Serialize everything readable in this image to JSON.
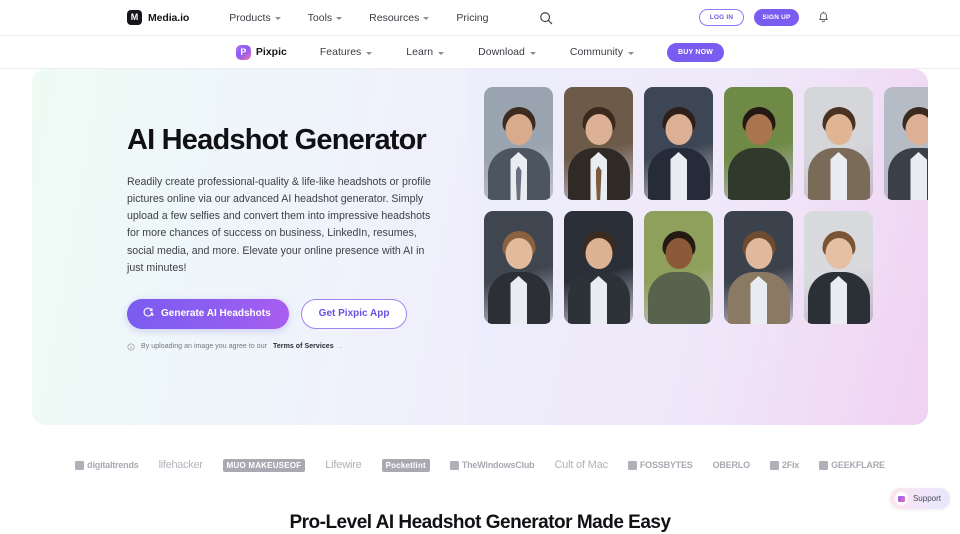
{
  "header": {
    "brand": {
      "name": "Media.io",
      "mark": "M",
      "icon": "mediaio-logo-icon"
    },
    "nav": [
      {
        "label": "Products",
        "has_caret": true
      },
      {
        "label": "Tools",
        "has_caret": true
      },
      {
        "label": "Resources",
        "has_caret": true
      },
      {
        "label": "Pricing",
        "has_caret": false
      }
    ],
    "search_icon": "search-icon",
    "login_label": "LOG IN",
    "signup_label": "SIGN UP",
    "bell_icon": "notification-bell-icon"
  },
  "subheader": {
    "brand": {
      "name": "Pixpic",
      "mark": "P",
      "icon": "pixpic-logo-icon"
    },
    "nav": [
      {
        "label": "Features",
        "has_caret": true
      },
      {
        "label": "Learn",
        "has_caret": true
      },
      {
        "label": "Download",
        "has_caret": true
      },
      {
        "label": "Community",
        "has_caret": true
      }
    ],
    "buy_now_label": "BUY NOW"
  },
  "hero": {
    "title": "AI Headshot Generator",
    "description": "Readily create professional-quality & life-like headshots or profile pictures online via our advanced AI headshot generator. Simply upload a few selfies and convert them into impressive headshots for more chances of success on business, LinkedIn, resumes, social media, and more. Elevate your online presence with AI in just minutes!",
    "primary_button": {
      "label": "Generate AI Headshots",
      "icon": "ai-magic-icon"
    },
    "secondary_button": {
      "label": "Get Pixpic App"
    },
    "terms": {
      "icon": "info-circle-icon",
      "prefix": "By uploading an image you agree to our ",
      "link_label": "Terms of Services",
      "suffix": "."
    },
    "gallery": {
      "rows": [
        [
          {
            "alt": "headshot-man-grey-suit",
            "skin": "#d9ab8d",
            "hair": "#3d2b20",
            "jacket": "#4d5560",
            "accent": "#6b717c",
            "bg": "#9aa4b0",
            "type": "suit"
          },
          {
            "alt": "headshot-man-brown-tie",
            "skin": "#dcb094",
            "hair": "#3a2a1e",
            "jacket": "#2f2a26",
            "accent": "#7a5c3c",
            "bg": "#6d5a49",
            "type": "suit"
          },
          {
            "alt": "headshot-man-navy-blazer",
            "skin": "#dcb094",
            "hair": "#2e2018",
            "jacket": "#262b3a",
            "accent": "#262b3a",
            "bg": "#3d4654",
            "type": "open"
          },
          {
            "alt": "headshot-man-green-tshirt",
            "skin": "#a9754e",
            "hair": "#241812",
            "jacket": "#2f3a2c",
            "accent": "#2f3a2c",
            "bg": "#6f8a47",
            "type": "casual"
          },
          {
            "alt": "headshot-man-tan-blazer",
            "skin": "#e0b594",
            "hair": "#4a3220",
            "jacket": "#7a6a58",
            "accent": "#7a6a58",
            "bg": "#d4d6da",
            "type": "open"
          },
          {
            "alt": "headshot-man-partial",
            "skin": "#dcb094",
            "hair": "#3a2a1e",
            "jacket": "#3a3f48",
            "accent": "#3a3f48",
            "bg": "#b6bcc6",
            "type": "open"
          }
        ],
        [
          {
            "alt": "headshot-woman-blonde-blazer",
            "skin": "#e3bb9c",
            "hair": "#8a6240",
            "jacket": "#2c2f36",
            "accent": "#9c8f7d",
            "bg": "#3f4650",
            "type": "open"
          },
          {
            "alt": "headshot-woman-dark-hair",
            "skin": "#dcb294",
            "hair": "#3a2a20",
            "jacket": "#2d3138",
            "accent": "#2d3138",
            "bg": "#2a2f38",
            "type": "open"
          },
          {
            "alt": "headshot-woman-curly-green",
            "skin": "#8c5a38",
            "hair": "#241a14",
            "jacket": "#57634c",
            "accent": "#57634c",
            "bg": "#8fa05c",
            "type": "casual"
          },
          {
            "alt": "headshot-woman-long-hair-tan",
            "skin": "#e0b99c",
            "hair": "#6f4b2f",
            "jacket": "#8a7a64",
            "accent": "#8a7a64",
            "bg": "#3b424c",
            "type": "open"
          },
          {
            "alt": "headshot-woman-white-shirt",
            "skin": "#e5c0a2",
            "hair": "#7a5434",
            "jacket": "#2b2f36",
            "accent": "#2b2f36",
            "bg": "#d8dadd",
            "type": "open"
          }
        ]
      ]
    }
  },
  "press_logos": [
    {
      "label": "digitaltrends",
      "style": "mark"
    },
    {
      "label": "lifehacker",
      "style": "light"
    },
    {
      "label": "MUO MAKEUSEOF",
      "style": "boxed"
    },
    {
      "label": "Lifewire",
      "style": "thin"
    },
    {
      "label": "Pocketlint",
      "style": "boxed"
    },
    {
      "label": "TheWindowsClub",
      "style": "mark"
    },
    {
      "label": "Cult of Mac",
      "style": "thin"
    },
    {
      "label": "FOSSBYTES",
      "style": "mark"
    },
    {
      "label": "OBERLO",
      "style": "bold"
    },
    {
      "label": "2Fix",
      "style": "mark"
    },
    {
      "label": "GEEKFLARE",
      "style": "mark"
    }
  ],
  "section": {
    "title": "Pro-Level AI Headshot Generator Made Easy"
  },
  "support": {
    "label": "Support",
    "icon": "support-chat-icon"
  },
  "colors": {
    "brand_purple": "#7b5cf0",
    "hero_gradient_start": "#edfbf4",
    "hero_gradient_mid": "#f0effc",
    "hero_gradient_end": "#ffe4e6"
  }
}
